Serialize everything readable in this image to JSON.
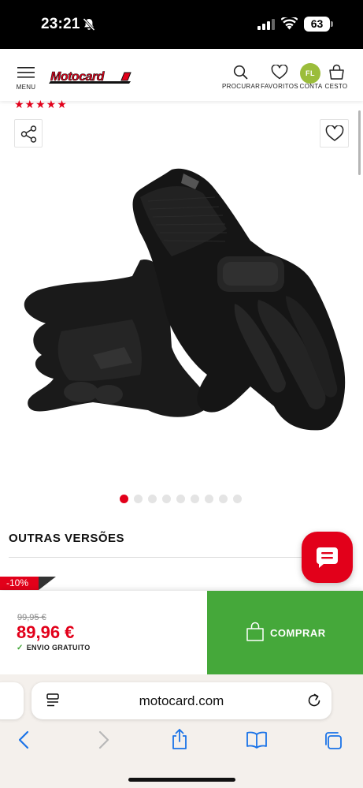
{
  "status_bar": {
    "time": "23:21",
    "battery": "63",
    "icons": [
      "bell-slash-icon",
      "cellular-signal-icon",
      "wifi-icon",
      "battery-icon"
    ]
  },
  "header": {
    "menu_label": "MENU",
    "logo_text": "Motocard",
    "search_label": "PROCURAR",
    "favorites_label": "FAVORITOS",
    "account_label": "CONTA",
    "account_initials": "FL",
    "cart_label": "CESTO",
    "brand_color": "#e2001a",
    "avatar_color": "#9bbd3b"
  },
  "product": {
    "rating_stars": "★★★★★",
    "image_alt": "gloves-product-image",
    "gallery_count": 9,
    "gallery_active_index": 0
  },
  "sections": {
    "other_versions_title": "OUTRAS VERSÕES",
    "discount_badge": "-10%"
  },
  "purchase": {
    "old_price": "99,95 €",
    "price": "89,96 €",
    "shipping": "ENVIO GRATUITO",
    "buy_label": "COMPRAR",
    "buy_color": "#45a83a"
  },
  "browser": {
    "url": "motocard.com",
    "toolbar_icons": [
      "back-icon",
      "forward-icon",
      "share-icon",
      "bookmarks-icon",
      "tabs-icon"
    ],
    "accent_color": "#1a73e8"
  }
}
